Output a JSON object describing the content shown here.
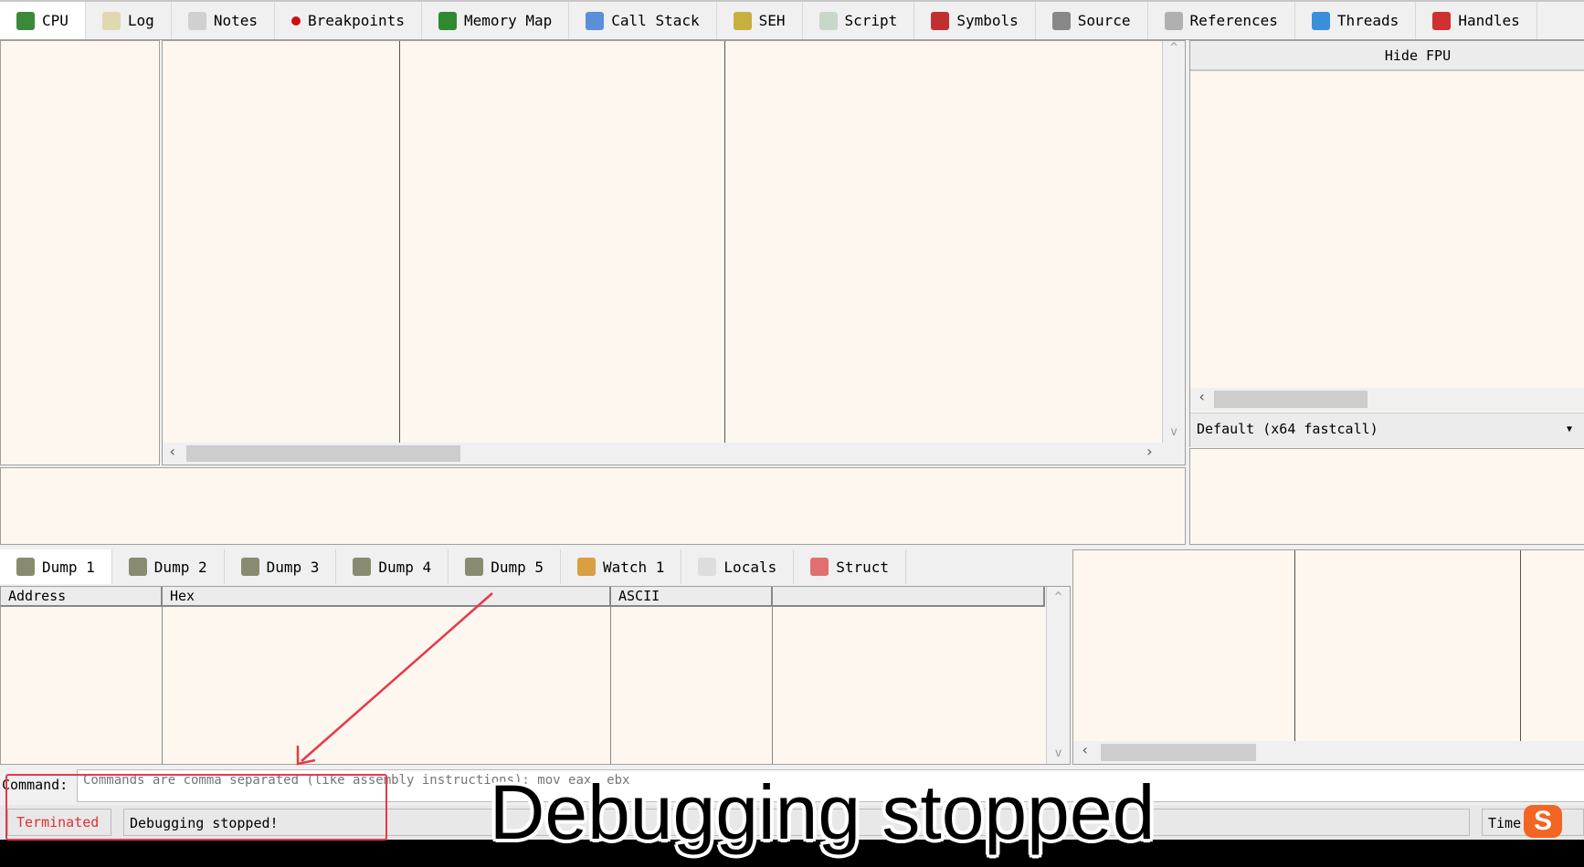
{
  "tabs": [
    {
      "label": "CPU",
      "icon": "cpu-icon",
      "color": "#3a8a3a"
    },
    {
      "label": "Log",
      "icon": "log-icon",
      "color": "#e0d8b0"
    },
    {
      "label": "Notes",
      "icon": "notes-icon",
      "color": "#d0d0d0"
    },
    {
      "label": "Breakpoints",
      "icon": "breakpoint-icon",
      "color": "#d01010"
    },
    {
      "label": "Memory Map",
      "icon": "memory-map-icon",
      "color": "#2f8a2f"
    },
    {
      "label": "Call Stack",
      "icon": "call-stack-icon",
      "color": "#5b8fd8"
    },
    {
      "label": "SEH",
      "icon": "seh-icon",
      "color": "#c8b040"
    },
    {
      "label": "Script",
      "icon": "script-icon",
      "color": "#c8d8c8"
    },
    {
      "label": "Symbols",
      "icon": "symbols-icon",
      "color": "#c03030"
    },
    {
      "label": "Source",
      "icon": "source-icon",
      "color": "#888888"
    },
    {
      "label": "References",
      "icon": "references-icon",
      "color": "#b0b0b0"
    },
    {
      "label": "Threads",
      "icon": "threads-icon",
      "color": "#3a90d8"
    },
    {
      "label": "Handles",
      "icon": "handles-icon",
      "color": "#d03030"
    }
  ],
  "registers": {
    "hide_fpu": "Hide FPU",
    "calling_convention": "Default (x64 fastcall)"
  },
  "dump_tabs": [
    {
      "label": "Dump 1",
      "icon": "dump-icon"
    },
    {
      "label": "Dump 2",
      "icon": "dump-icon"
    },
    {
      "label": "Dump 3",
      "icon": "dump-icon"
    },
    {
      "label": "Dump 4",
      "icon": "dump-icon"
    },
    {
      "label": "Dump 5",
      "icon": "dump-icon"
    },
    {
      "label": "Watch 1",
      "icon": "watch-icon"
    },
    {
      "label": "Locals",
      "icon": "locals-icon"
    },
    {
      "label": "Struct",
      "icon": "struct-icon"
    }
  ],
  "dump_columns": [
    "Address",
    "Hex",
    "ASCII",
    ""
  ],
  "command": {
    "label": "Command:",
    "placeholder": "Commands are comma separated (like assembly instructions): mov eax, ebx"
  },
  "status": {
    "state": "Terminated",
    "message": "Debugging stopped!",
    "time_label": "Time"
  },
  "caption": "Debugging stopped",
  "colors": {
    "panel_bg": "#fdf7f0",
    "annotation": "#e8384a",
    "terminated": "#e03030"
  }
}
